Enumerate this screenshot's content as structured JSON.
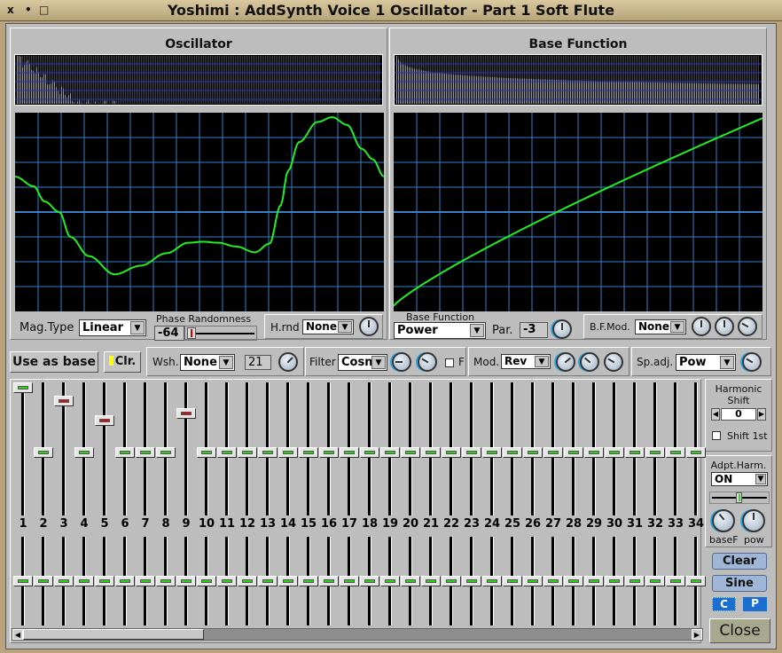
{
  "window": {
    "title": "Yoshimi : AddSynth Voice 1 Oscillator - Part 1 Soft Flute",
    "controls": [
      "x",
      "•",
      "□"
    ]
  },
  "oscillator": {
    "title": "Oscillator",
    "mag_type_label": "Mag.Type",
    "mag_type_value": "Linear",
    "phase_rand_label": "Phase Randomness",
    "phase_rand_value": "-64",
    "hrnd_label": "H.rnd",
    "hrnd_value": "None"
  },
  "base_function": {
    "title": "Base Function",
    "label": "Base Function",
    "value": "Power",
    "par_label": "Par.",
    "par_value": "-3",
    "bfmod_label": "B.F.Mod.",
    "bfmod_value": "None"
  },
  "toolbar": {
    "use_as_base": "Use as base",
    "clr": "Clr.",
    "wsh_label": "Wsh.",
    "wsh_value": "None",
    "wsh_amount": "21",
    "filter_label": "Filter",
    "filter_value": "Cosn",
    "filter_f": "F",
    "mod_label": "Mod.",
    "mod_value": "Rev",
    "spadj_label": "Sp.adj.",
    "spadj_value": "Pow"
  },
  "harmonics": {
    "numbers": [
      "1",
      "2",
      "3",
      "4",
      "5",
      "6",
      "7",
      "8",
      "9",
      "10",
      "11",
      "12",
      "13",
      "14",
      "15",
      "16",
      "17",
      "18",
      "19",
      "20",
      "21",
      "22",
      "23",
      "24",
      "25",
      "26",
      "27",
      "28",
      "29",
      "30",
      "31",
      "32",
      "33",
      "34"
    ],
    "magnitude_positions": [
      0,
      0.5,
      0.1,
      0.5,
      0.25,
      0.5,
      0.5,
      0.5,
      0.2,
      0.5,
      0.5,
      0.5,
      0.5,
      0.5,
      0.5,
      0.5,
      0.5,
      0.5,
      0.5,
      0.5,
      0.5,
      0.5,
      0.5,
      0.5,
      0.5,
      0.5,
      0.5,
      0.5,
      0.5,
      0.5,
      0.5,
      0.5,
      0.5,
      0.5
    ],
    "active": [
      true,
      false,
      true,
      false,
      true,
      false,
      false,
      false,
      true,
      false,
      false,
      false,
      false,
      false,
      false,
      false,
      false,
      false,
      false,
      false,
      false,
      false,
      false,
      false,
      false,
      false,
      false,
      false,
      false,
      false,
      false,
      false,
      false,
      false
    ],
    "phase_positions": [
      0.5,
      0.5,
      0.5,
      0.5,
      0.5,
      0.5,
      0.5,
      0.5,
      0.5,
      0.5,
      0.5,
      0.5,
      0.5,
      0.5,
      0.5,
      0.5,
      0.5,
      0.5,
      0.5,
      0.5,
      0.5,
      0.5,
      0.5,
      0.5,
      0.5,
      0.5,
      0.5,
      0.5,
      0.5,
      0.5,
      0.5,
      0.5,
      0.5,
      0.5
    ],
    "scroll_fraction": 0.27
  },
  "side": {
    "harmonic_shift_label": "Harmonic Shift",
    "harmonic_shift_value": "0",
    "shift1st_label": "Shift 1st",
    "adpt_label": "Adpt.Harm.",
    "adpt_value": "ON",
    "basef_label": "baseF",
    "pow_label": "pow",
    "clear": "Clear",
    "sine": "Sine",
    "c": "C",
    "p": "P",
    "close": "Close"
  },
  "colors": {
    "spectrum_bg": "#2233dd",
    "bar": "#22ee22",
    "grid": "#3a7ec8",
    "trace": "#22ee22"
  }
}
